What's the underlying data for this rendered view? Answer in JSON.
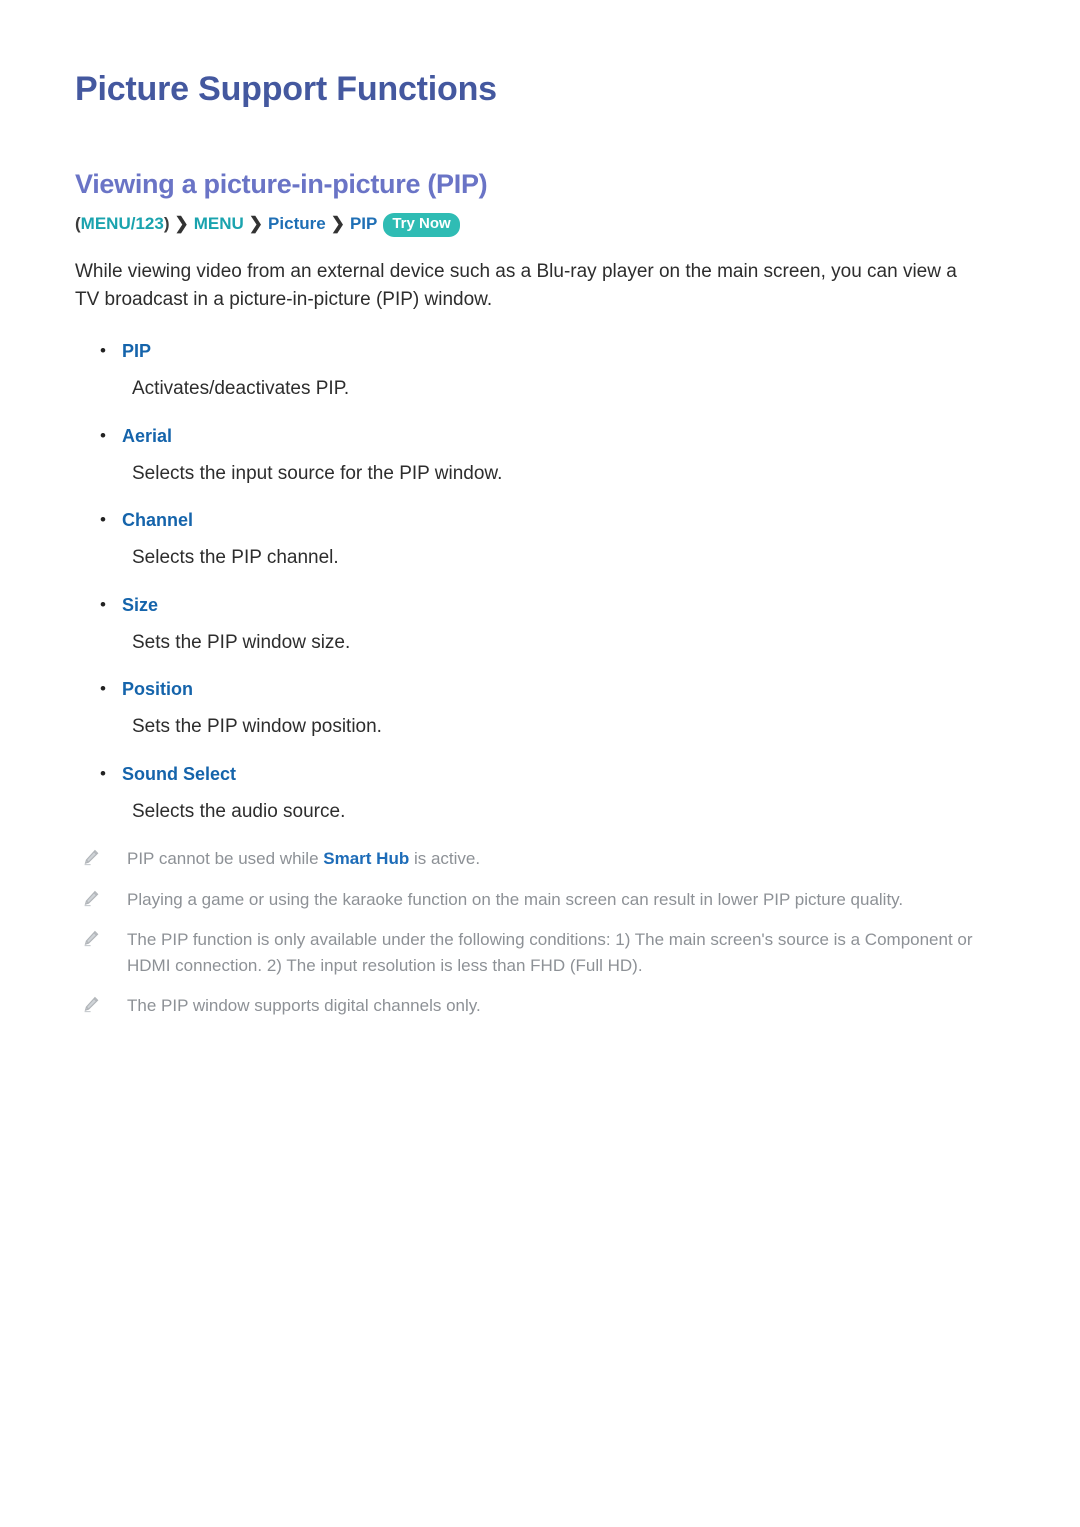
{
  "page": {
    "title": "Picture Support Functions",
    "section_title": "Viewing a picture-in-picture (PIP)"
  },
  "breadcrumb": {
    "open_paren": "(",
    "menu123": "MENU/123",
    "close_paren": ")",
    "separator": "❯",
    "menu": "MENU",
    "picture": "Picture",
    "pip": "PIP",
    "try_now": "Try Now"
  },
  "intro": "While viewing video from an external device such as a Blu-ray player on the main screen, you can view a TV broadcast in a picture-in-picture (PIP) window.",
  "bullet_glyph": "•",
  "options": [
    {
      "label": "PIP",
      "desc": "Activates/deactivates PIP."
    },
    {
      "label": "Aerial",
      "desc": "Selects the input source for the PIP window."
    },
    {
      "label": "Channel",
      "desc": "Selects the PIP channel."
    },
    {
      "label": "Size",
      "desc": "Sets the PIP window size."
    },
    {
      "label": "Position",
      "desc": "Sets the PIP window position."
    },
    {
      "label": "Sound Select",
      "desc": "Selects the audio source."
    }
  ],
  "notes": [
    {
      "before": "PIP cannot be used while ",
      "highlight": "Smart Hub",
      "after": " is active."
    },
    {
      "before": "Playing a game or using the karaoke function on the main screen can result in lower PIP picture quality.",
      "highlight": "",
      "after": ""
    },
    {
      "before": "The PIP function is only available under the following conditions: 1) The main screen's source is a Component or HDMI connection. 2) The input resolution is less than FHD (Full HD).",
      "highlight": "",
      "after": ""
    },
    {
      "before": "The PIP window supports digital channels only.",
      "highlight": "",
      "after": ""
    }
  ],
  "colors": {
    "page_title": "#44589f",
    "section_title": "#6a74c6",
    "option_label": "#1564ab",
    "breadcrumb_teal": "#1aa3ae",
    "breadcrumb_blue": "#1f6fb5",
    "try_now_badge": "#2fbcb4",
    "note_text": "#8d9196",
    "note_highlight": "#1d6cb8",
    "body_text": "#2d2d2d"
  }
}
